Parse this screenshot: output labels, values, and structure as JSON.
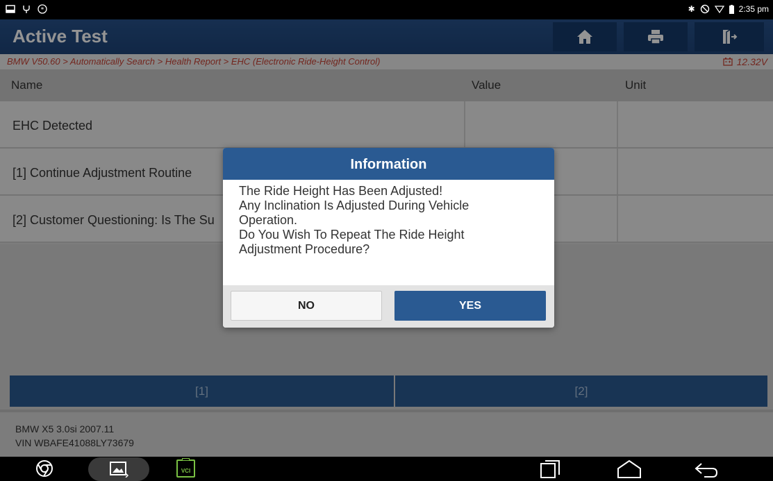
{
  "status_bar": {
    "time": "2:35 pm"
  },
  "header": {
    "title": "Active Test"
  },
  "breadcrumb": {
    "path": "BMW V50.60 > Automatically Search > Health Report > EHC (Electronic Ride-Height Control)",
    "voltage": "12.32V"
  },
  "table": {
    "columns": [
      "Name",
      "Value",
      "Unit"
    ],
    "rows": [
      {
        "name": "EHC Detected",
        "value": "",
        "unit": ""
      },
      {
        "name": "[1] Continue Adjustment Routine",
        "value": "",
        "unit": ""
      },
      {
        "name": "[2] Customer Questioning: Is The Su",
        "value": "",
        "unit": ""
      }
    ]
  },
  "bottom_buttons": [
    "[1]",
    "[2]"
  ],
  "vehicle": {
    "model": "BMW X5 3.0si 2007.11",
    "vin": "VIN WBAFE41088LY73679"
  },
  "nav": {
    "vci_label": "VCI"
  },
  "dialog": {
    "title": "Information",
    "lines": [
      "The Ride Height Has Been Adjusted!",
      "Any Inclination Is Adjusted During Vehicle",
      "Operation.",
      "Do You Wish To Repeat The Ride Height",
      "Adjustment Procedure?"
    ],
    "no_label": "NO",
    "yes_label": "YES"
  },
  "colors": {
    "header_blue": "#27518a",
    "button_blue": "#2a5a92",
    "breadcrumb_red": "#c64235"
  }
}
